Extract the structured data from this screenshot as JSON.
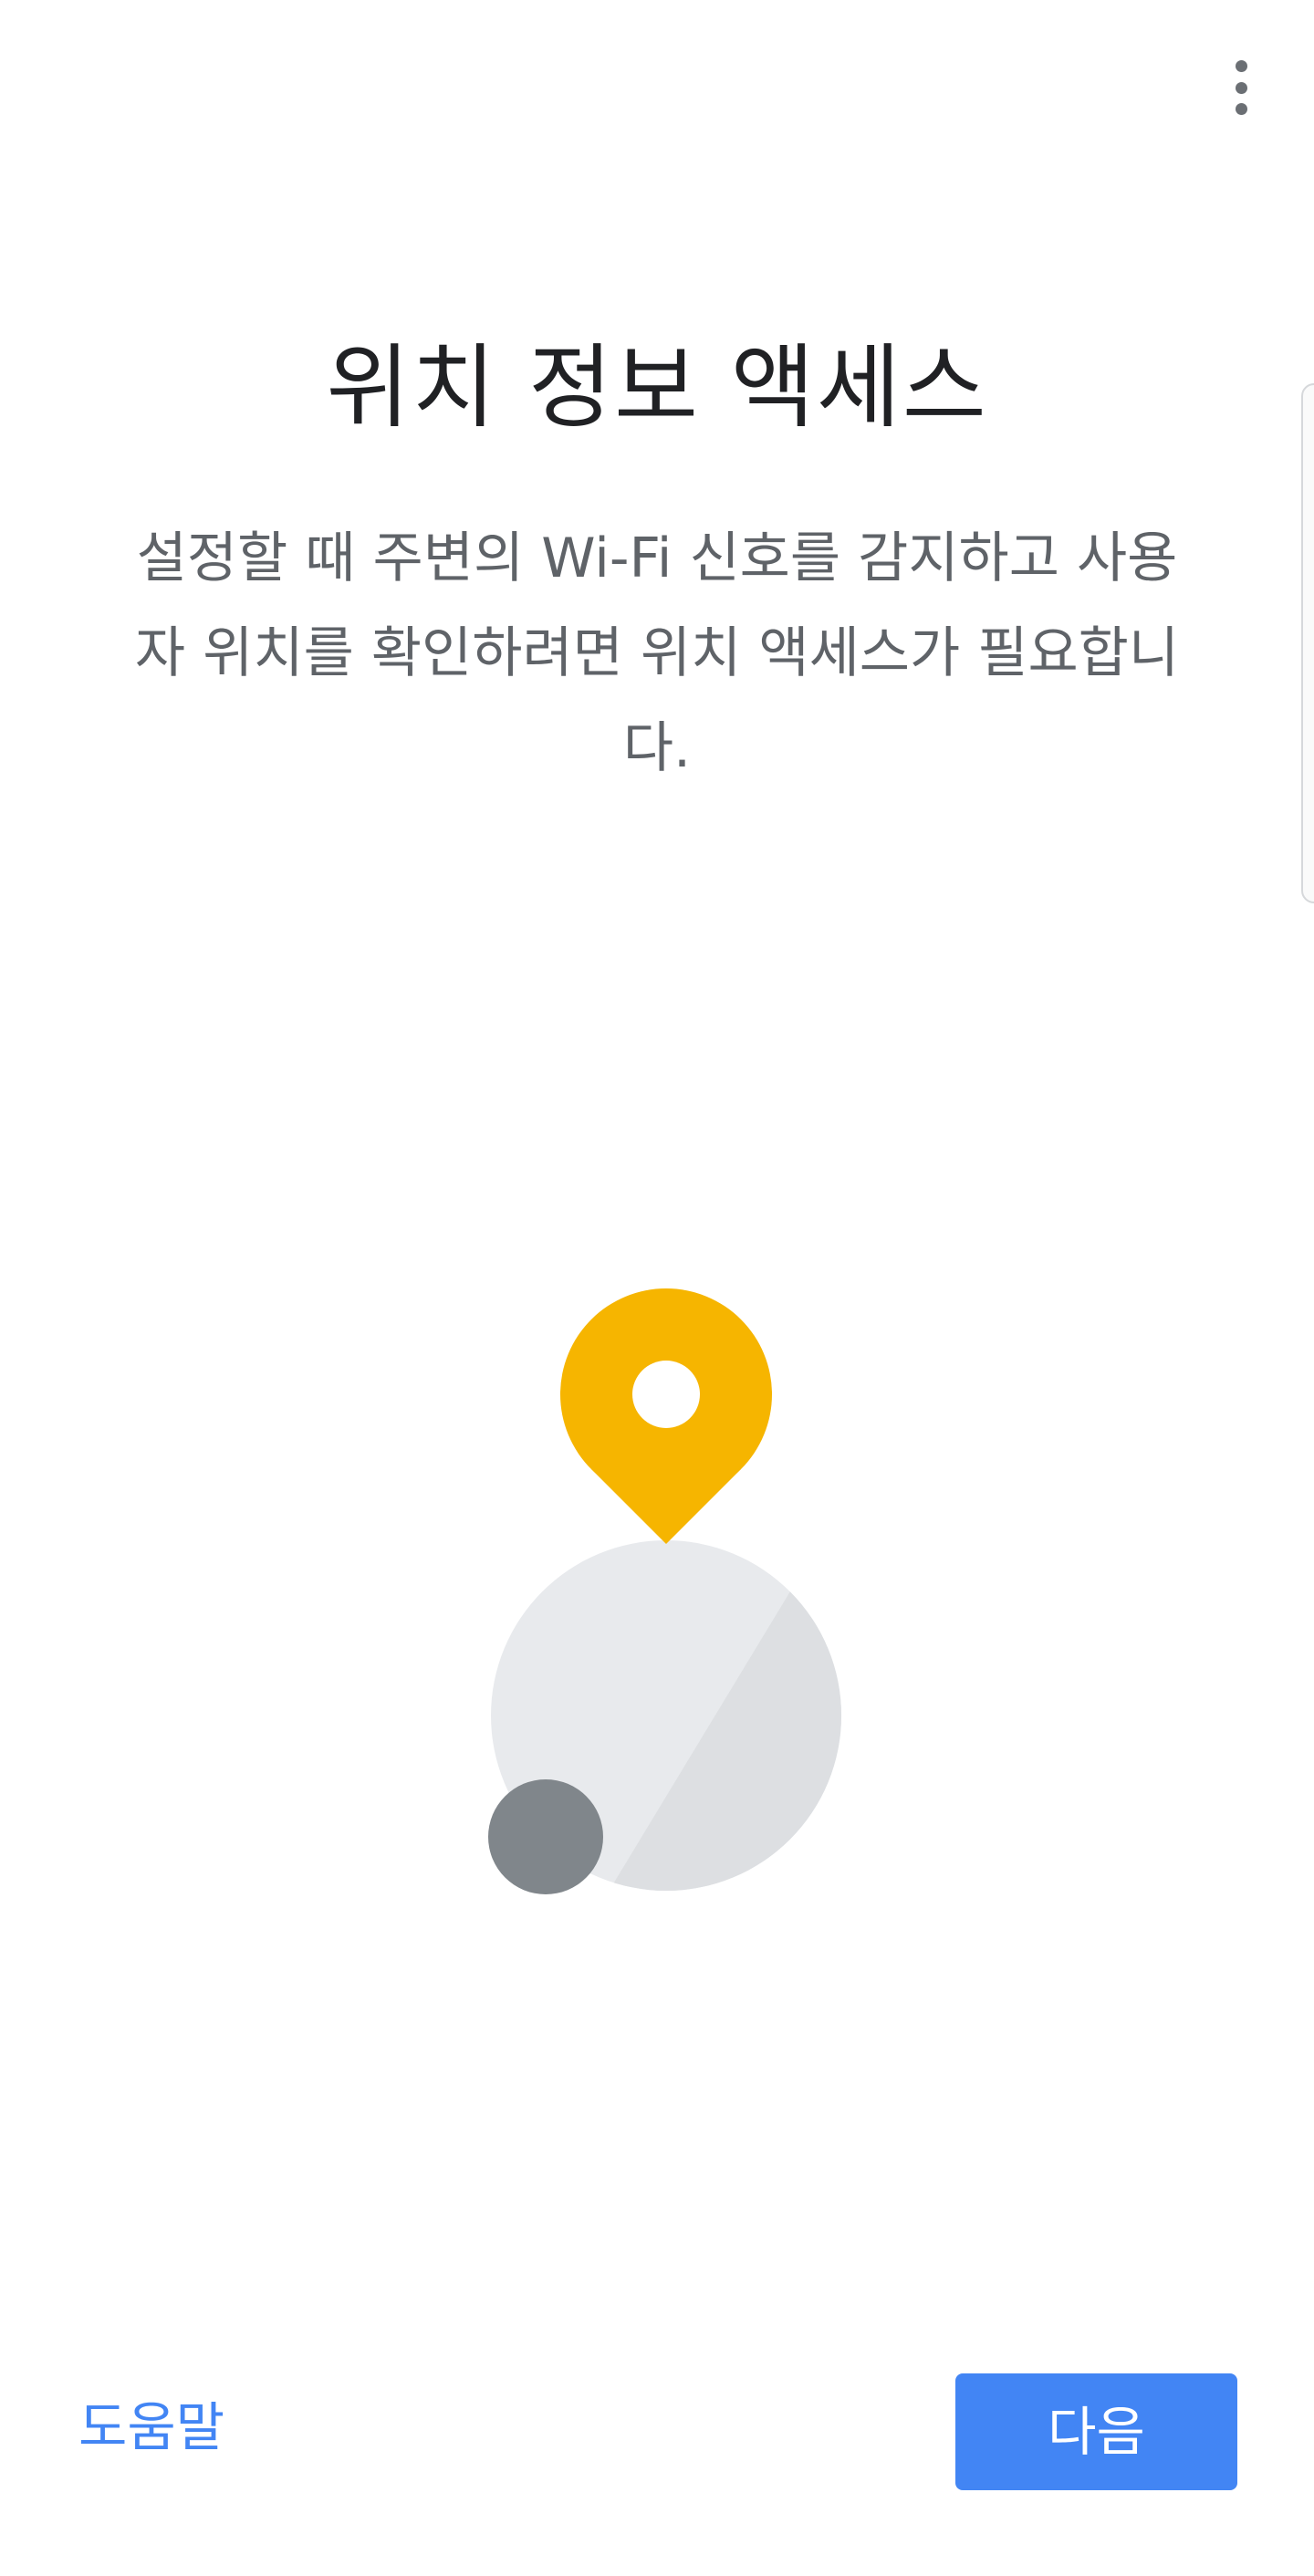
{
  "header": {
    "overflow_icon": "more-vert-icon"
  },
  "main": {
    "title": "위치 정보 액세스",
    "description": "설정할 때 주변의 Wi-Fi 신호를 감지하고 사용자 위치를 확인하려면 위치 액세스가 필요합니다.",
    "illustration": {
      "pin_icon": "location-pin-icon",
      "pin_color": "#F6B500",
      "sphere_color": "#E8EAED",
      "sphere_shade_color": "#DDDFE2",
      "dot_color": "#80868B"
    }
  },
  "footer": {
    "help_label": "도움말",
    "next_label": "다음",
    "accent_color": "#4285F4"
  }
}
